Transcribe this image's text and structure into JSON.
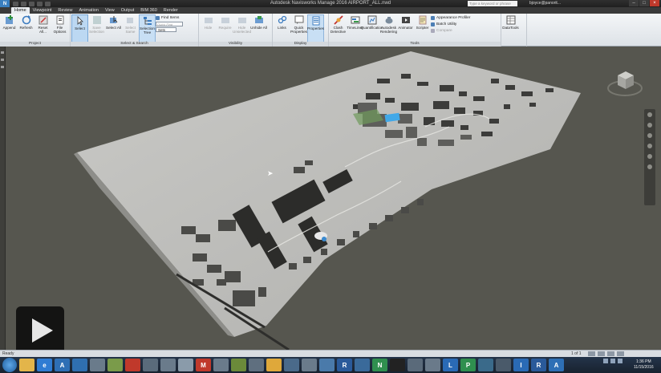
{
  "window": {
    "title": "Autodesk Navisworks Manage 2016    AIRPORT_ALL.nwd",
    "help_search_placeholder": "Type a keyword or phrase",
    "sign_in": "bjoyce@panorit...",
    "app_logo": "N"
  },
  "tabs": [
    "Home",
    "Viewpoint",
    "Review",
    "Animation",
    "View",
    "Output",
    "BIM 360",
    "Render"
  ],
  "active_tab": "Home",
  "ribbon": {
    "project": {
      "label": "Project",
      "buttons": [
        "Append",
        "Refresh",
        "Reset All...",
        "File Options"
      ]
    },
    "select_search": {
      "label": "Select & Search",
      "buttons": [
        "Select",
        "Save Selection",
        "Select All",
        "Select Same",
        "Selection Tree"
      ],
      "find_items": "Find Items",
      "quick_find_placeholder": "Quick Find",
      "sets": "Sets"
    },
    "visibility": {
      "label": "Visibility",
      "buttons": [
        "Hide",
        "Require",
        "Hide Unselected",
        "Unhide All"
      ]
    },
    "display": {
      "label": "Display",
      "buttons": [
        "Links",
        "Quick Properties",
        "Properties"
      ]
    },
    "tools": {
      "label": "Tools",
      "buttons": [
        "Clash Detective",
        "TimeLiner",
        "Quantification",
        "Autodesk Rendering",
        "Animator",
        "Scripter"
      ],
      "small": [
        "Appearance Profiler",
        "Batch Utility",
        "Compare"
      ]
    },
    "datatools": {
      "buttons": [
        "DataTools"
      ]
    }
  },
  "status": {
    "ready": "Ready",
    "page": "1 of 1"
  },
  "taskbar": {
    "apps": [
      {
        "icon": "folder-icon",
        "color": "#e3b54a",
        "glyph": ""
      },
      {
        "icon": "ie-icon",
        "color": "#2f7cd3",
        "glyph": "e"
      },
      {
        "icon": "autodesk-a-icon",
        "color": "#2e6fb5",
        "glyph": "A"
      },
      {
        "icon": "media-icon",
        "color": "#2f6fb0",
        "glyph": ""
      },
      {
        "icon": "app-icon",
        "color": "#6a7b8b",
        "glyph": ""
      },
      {
        "icon": "paint-icon",
        "color": "#7a9b4a",
        "glyph": ""
      },
      {
        "icon": "red-app-icon",
        "color": "#c0392b",
        "glyph": ""
      },
      {
        "icon": "app-icon",
        "color": "#5a6b7b",
        "glyph": ""
      },
      {
        "icon": "app-icon",
        "color": "#6a7b8b",
        "glyph": ""
      },
      {
        "icon": "app-icon",
        "color": "#8a9baa",
        "glyph": ""
      },
      {
        "icon": "gmail-icon",
        "color": "#c0392b",
        "glyph": "M"
      },
      {
        "icon": "app-icon",
        "color": "#6a7b8b",
        "glyph": ""
      },
      {
        "icon": "app-icon",
        "color": "#6b8a3a",
        "glyph": ""
      },
      {
        "icon": "app-icon",
        "color": "#5f6f7f",
        "glyph": ""
      },
      {
        "icon": "chrome-icon",
        "color": "#dfa83a",
        "glyph": ""
      },
      {
        "icon": "app-icon",
        "color": "#4a6a8a",
        "glyph": ""
      },
      {
        "icon": "app-icon",
        "color": "#6a7b8b",
        "glyph": ""
      },
      {
        "icon": "app-icon",
        "color": "#4a7aaa",
        "glyph": ""
      },
      {
        "icon": "revit-icon",
        "color": "#2a5a9a",
        "glyph": "R"
      },
      {
        "icon": "app-icon",
        "color": "#3a6a9a",
        "glyph": ""
      },
      {
        "icon": "navisworks-icon",
        "color": "#2f8f4f",
        "glyph": "N"
      },
      {
        "icon": "terminal-icon",
        "color": "#222222",
        "glyph": ""
      },
      {
        "icon": "app-icon",
        "color": "#5a6a7a",
        "glyph": ""
      },
      {
        "icon": "app-icon",
        "color": "#6a7a8a",
        "glyph": ""
      },
      {
        "icon": "lync-icon",
        "color": "#2a6ab5",
        "glyph": "L"
      },
      {
        "icon": "project-icon",
        "color": "#2f8f4f",
        "glyph": "P"
      },
      {
        "icon": "app-icon",
        "color": "#3a6a8a",
        "glyph": ""
      },
      {
        "icon": "app-icon",
        "color": "#4a5a6a",
        "glyph": ""
      },
      {
        "icon": "infraworks-icon",
        "color": "#2a6ab5",
        "glyph": "I"
      },
      {
        "icon": "revit-icon",
        "color": "#2a5a9a",
        "glyph": "R"
      },
      {
        "icon": "autodesk-a-icon",
        "color": "#2e6fb5",
        "glyph": "A"
      }
    ],
    "time": "1:36 PM",
    "date": "11/15/2016"
  },
  "colors": {
    "ribbon_bg": "#eef1f4",
    "viewport_bg": "#56564f",
    "accent": "#3a7fc0"
  }
}
